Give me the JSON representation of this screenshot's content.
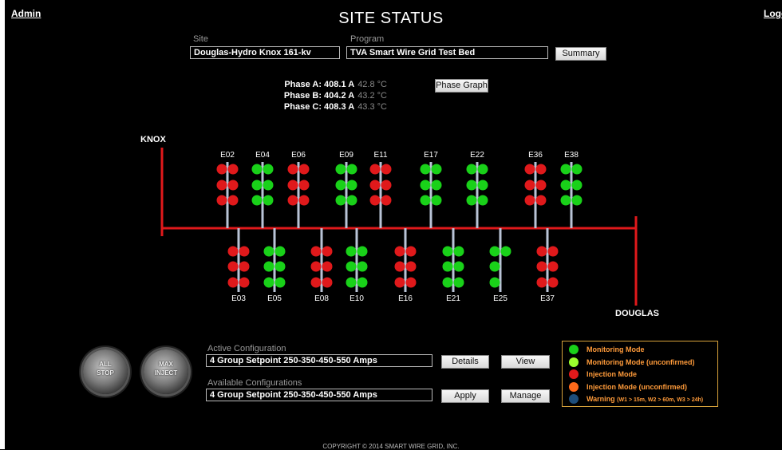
{
  "header": {
    "admin_link": "Admin",
    "logout_link": "Logou",
    "title": "SITE STATUS"
  },
  "site": {
    "label": "Site",
    "value": "Douglas-Hydro Knox 161-kv"
  },
  "program": {
    "label": "Program",
    "value": "TVA Smart Wire Grid Test Bed",
    "summary_button": "Summary"
  },
  "phases": [
    {
      "name": "Phase A:",
      "amps": "408.1 A",
      "temp": "42.8 °C"
    },
    {
      "name": "Phase B:",
      "amps": "404.2 A",
      "temp": "43.2 °C"
    },
    {
      "name": "Phase C:",
      "amps": "408.3 A",
      "temp": "43.3 °C"
    }
  ],
  "phase_graph_button": "Phase Graph",
  "diagram": {
    "source_label": "KNOX",
    "sink_label": "DOUGLAS",
    "bus_color": "#e0191b",
    "upper_groups": [
      {
        "label": "E02",
        "state": [
          "red",
          "red",
          "red"
        ]
      },
      {
        "label": "E04",
        "state": [
          "green",
          "green",
          "green"
        ]
      },
      {
        "label": "E06",
        "state": [
          "red",
          "red",
          "red"
        ]
      },
      {
        "label": "E09",
        "state": [
          "green",
          "green",
          "green"
        ]
      },
      {
        "label": "E11",
        "state": [
          "red",
          "red",
          "red"
        ]
      },
      {
        "label": "E17",
        "state": [
          "green",
          "green",
          "green"
        ]
      },
      {
        "label": "E22",
        "state": [
          "green",
          "green",
          "green"
        ]
      },
      {
        "label": "E36",
        "state": [
          "red",
          "red",
          "red"
        ]
      },
      {
        "label": "E38",
        "state": [
          "green",
          "green",
          "green"
        ]
      }
    ],
    "lower_groups": [
      {
        "label": "E03",
        "state": [
          "red",
          "red",
          "red"
        ]
      },
      {
        "label": "E05",
        "state": [
          "green",
          "green",
          "green"
        ]
      },
      {
        "label": "E08",
        "state": [
          "red",
          "red",
          "red"
        ]
      },
      {
        "label": "E10",
        "state": [
          "green",
          "green",
          "green"
        ]
      },
      {
        "label": "E16",
        "state": [
          "red",
          "red",
          "red"
        ]
      },
      {
        "label": "E21",
        "state": [
          "green",
          "green",
          "green"
        ]
      },
      {
        "label": "E25",
        "state": [
          "green-right",
          "green-single",
          "green-single"
        ]
      },
      {
        "label": "E37",
        "state": [
          "red",
          "red",
          "red"
        ]
      }
    ]
  },
  "controls": {
    "all_stop": "ALL\nSTOP",
    "max_inject": "MAX\nINJECT"
  },
  "active_config": {
    "label": "Active Configuration",
    "value": "4 Group Setpoint 250-350-450-550 Amps",
    "details_button": "Details",
    "view_button": "View"
  },
  "available_config": {
    "label": "Available Configurations",
    "value": "4 Group Setpoint 250-350-450-550 Amps",
    "apply_button": "Apply",
    "manage_button": "Manage"
  },
  "legend": [
    {
      "text": "Monitoring Mode",
      "color": "#19d119",
      "note": ""
    },
    {
      "text": "Monitoring Mode (unconfirmed)",
      "color": "#9cff2e",
      "note": ""
    },
    {
      "text": "Injection Mode",
      "color": "#e0191b",
      "note": ""
    },
    {
      "text": "Injection Mode (unconfirmed)",
      "color": "#ff6a1a",
      "note": ""
    },
    {
      "text": "Warning",
      "color": "#1d4d7a",
      "note": "(W1 > 15m, W2 > 60m, W3 > 24h)"
    }
  ],
  "colors": {
    "red": "#e0191b",
    "green": "#19d119",
    "conductor": "#b9c3d6"
  },
  "footer": {
    "copyright": "COPYRIGHT © 2014 SMART WIRE GRID, INC."
  }
}
